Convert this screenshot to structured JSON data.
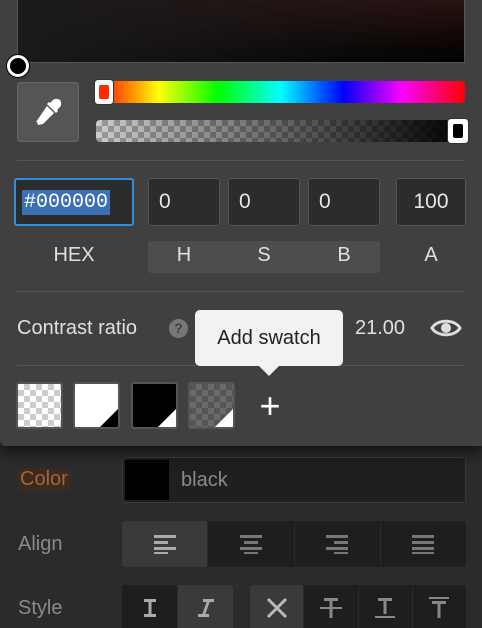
{
  "picker": {
    "hex_value": "#000000",
    "h_value": "0",
    "s_value": "0",
    "b_value": "0",
    "a_value": "100",
    "labels": {
      "hex": "HEX",
      "h": "H",
      "s": "S",
      "b": "B",
      "a": "A"
    },
    "hue_handle_color": "#ff2a00"
  },
  "contrast": {
    "label": "Contrast ratio",
    "help": "?",
    "value": "21.00"
  },
  "tooltip": {
    "text": "Add swatch"
  },
  "swatches": {
    "items": [
      "transparent",
      "white",
      "black",
      "transparent-grey"
    ],
    "add_label": "+"
  },
  "style_panel": {
    "color_label": "Color",
    "color_value": "black",
    "color_hex": "#000000",
    "align_label": "Align",
    "style_label": "Style"
  },
  "colors": {
    "accent": "#2f8fe0",
    "panel": "#404040",
    "background": "#2b2b2b"
  }
}
